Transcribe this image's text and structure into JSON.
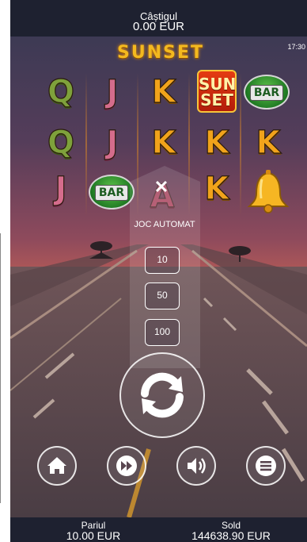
{
  "header": {
    "win_label": "Câștigul",
    "win_value": "0.00 EUR"
  },
  "status": {
    "time": "17:30"
  },
  "logo": {
    "text": "SUNSET"
  },
  "reels": {
    "row1": [
      "Q",
      "J",
      "K",
      "SUN SET",
      "BAR"
    ],
    "row2": [
      "Q",
      "J",
      "K",
      "K",
      "K"
    ],
    "row3": [
      "J",
      "BAR",
      "A",
      "K",
      "bell"
    ]
  },
  "sunset_tile": {
    "line1": "SUN",
    "line2": "SET"
  },
  "bar_label": "BAR",
  "autoplay": {
    "title": "JOC AUTOMAT",
    "options": [
      "10",
      "50",
      "100"
    ]
  },
  "controls": {
    "spin_icon": "refresh-icon",
    "home_icon": "home-icon",
    "fast_icon": "fast-forward-icon",
    "sound_icon": "sound-icon",
    "menu_icon": "menu-icon"
  },
  "footer": {
    "bet_label": "Pariul",
    "bet_value": "10.00 EUR",
    "balance_label": "Sold",
    "balance_value": "144638.90 EUR"
  },
  "colors": {
    "bar": "#1e2130",
    "gold": "#f3b91f"
  }
}
